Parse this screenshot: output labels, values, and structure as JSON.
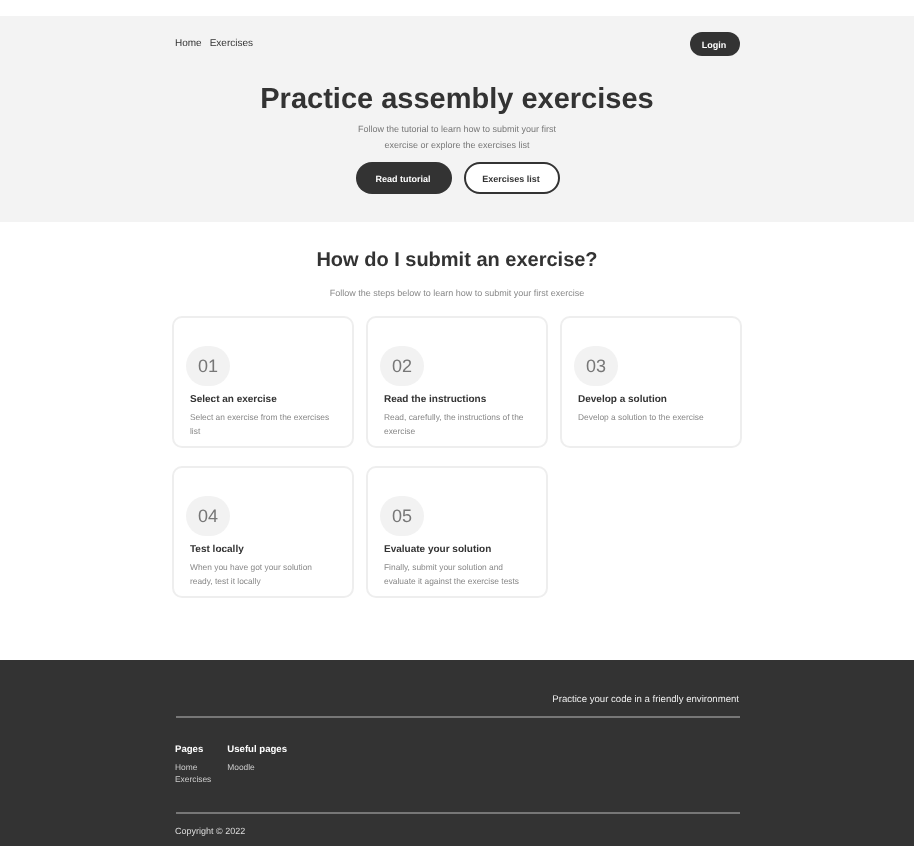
{
  "nav": {
    "links": [
      "Home",
      "Exercises"
    ],
    "login": "Login"
  },
  "hero": {
    "title": "Practice assembly exercises",
    "subtitle": "Follow the tutorial to learn how to submit your first exercise or explore the exercises list",
    "buttons": [
      {
        "label": "Read tutorial",
        "kind": "filled"
      },
      {
        "label": "Exercises list",
        "kind": "outline"
      }
    ]
  },
  "steps": {
    "title": "How do I submit an exercise?",
    "subtitle": "Follow the steps below to learn how to submit your first exercise",
    "items": [
      {
        "number": "01",
        "title": "Select an exercise",
        "text": "Select an exercise from the exercises list"
      },
      {
        "number": "02",
        "title": "Read the instructions",
        "text": "Read, carefully, the instructions of the exercise"
      },
      {
        "number": "03",
        "title": "Develop a solution",
        "text": "Develop a solution to the exercise"
      },
      {
        "number": "04",
        "title": "Test locally",
        "text": "When you have got your solution ready, test it locally"
      },
      {
        "number": "05",
        "title": "Evaluate your solution",
        "text": "Finally, submit your solution and evaluate it against the exercise tests"
      }
    ]
  },
  "footer": {
    "tagline": "Practice your code in a friendly environment",
    "columns": [
      {
        "heading": "Pages",
        "links": [
          "Home",
          "Exercises"
        ]
      },
      {
        "heading": "Useful pages",
        "links": [
          "Moodle"
        ]
      }
    ],
    "copyright": "Copyright © 2022"
  }
}
